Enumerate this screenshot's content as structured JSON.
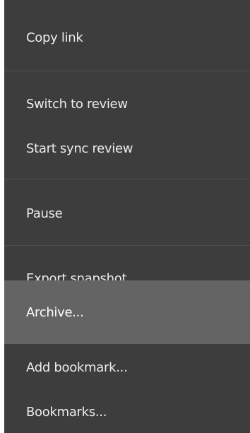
{
  "menu": {
    "items": [
      {
        "label": "Copy link"
      },
      {
        "label": "Switch to review"
      },
      {
        "label": "Start sync review"
      },
      {
        "label": "Pause"
      },
      {
        "label": "Export snapshot..."
      },
      {
        "label": "Archive...",
        "highlighted": true
      },
      {
        "label": "Add bookmark..."
      },
      {
        "label": "Bookmarks..."
      }
    ]
  },
  "colors": {
    "menu_background": "#3d3d3d",
    "highlight_background": "#646464",
    "separator": "#4f4f4f",
    "text": "#ececec"
  }
}
